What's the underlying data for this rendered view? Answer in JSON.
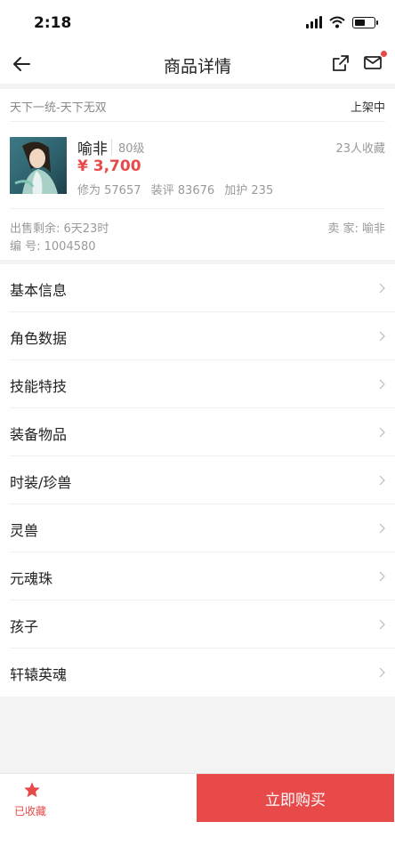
{
  "status_bar": {
    "time": "2:18"
  },
  "nav": {
    "title": "商品详情"
  },
  "product": {
    "server": "天下一统-天下无双",
    "listing_status": "上架中",
    "role_name": "喻非",
    "level": "80级",
    "collect_count": "23人收藏",
    "price": "¥ 3,700",
    "stats": [
      "修为 57657",
      "装评 83676",
      "加护 235"
    ],
    "remain_time": "出售剩余: 6天23时",
    "seller": "卖 家: 喻非",
    "serial": "编 号: 1004580"
  },
  "menu": [
    {
      "label": "基本信息"
    },
    {
      "label": "角色数据"
    },
    {
      "label": "技能特技"
    },
    {
      "label": "装备物品"
    },
    {
      "label": "时装/珍兽"
    },
    {
      "label": "灵兽"
    },
    {
      "label": "元魂珠"
    },
    {
      "label": "孩子"
    },
    {
      "label": "轩辕英魂"
    }
  ],
  "bottom": {
    "favorite_label": "已收藏",
    "buy_label": "立即购买"
  },
  "colors": {
    "accent": "#e84a4a",
    "text_primary": "#222222",
    "text_secondary": "#999999",
    "background": "#f3f3f3"
  },
  "icons": {
    "back": "arrow-left-icon",
    "share": "share-icon",
    "mail": "mail-icon",
    "chevron": "chevron-right-icon",
    "favorite": "star-icon"
  }
}
